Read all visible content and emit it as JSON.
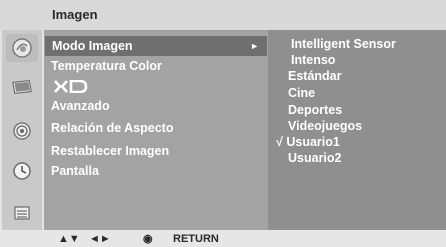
{
  "header": {
    "title": "Imagen"
  },
  "menu": {
    "items": [
      {
        "label": "Modo Imagen",
        "selected": true
      },
      {
        "label": "Temperatura Color",
        "selected": false
      },
      {
        "label": "XD",
        "selected": false
      },
      {
        "label": "Avanzado",
        "selected": false
      },
      {
        "label": "Relación de Aspecto",
        "selected": false
      },
      {
        "label": "Restablecer Imagen",
        "selected": false
      },
      {
        "label": "Pantalla",
        "selected": false
      }
    ],
    "submenu_arrow": "►"
  },
  "submenu": {
    "options": [
      {
        "label": "Intelligent Sensor"
      },
      {
        "label": "Intenso"
      },
      {
        "label": "Estándar"
      },
      {
        "label": "Cine"
      },
      {
        "label": "Deportes"
      },
      {
        "label": "Videojuegos"
      },
      {
        "label": "Usuario1",
        "checked": true,
        "mark": "√"
      },
      {
        "label": "Usuario2"
      }
    ]
  },
  "footer": {
    "nav_updown": "▲▼",
    "nav_leftright": "◄►",
    "ok_symbol": "◉",
    "return_label": "RETURN"
  },
  "colors": {
    "menu_bg": "#a3a3a3",
    "menu_selected": "#6f6f6f",
    "submenu_bg": "#8f8f8f",
    "rail_bg": "#c9c9c9"
  },
  "icons": [
    "picture-icon",
    "screen-icon",
    "audio-icon",
    "clock-icon",
    "options-icon"
  ]
}
